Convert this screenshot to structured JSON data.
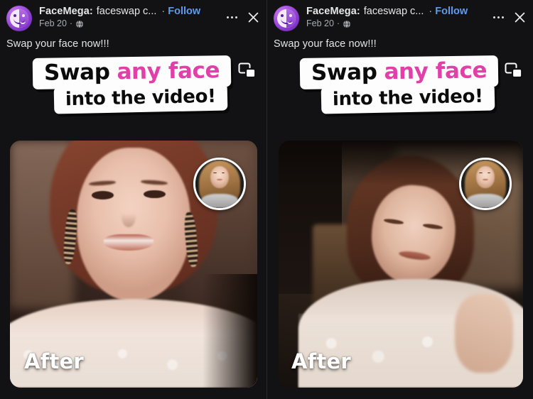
{
  "post": {
    "page_name": "FaceMega",
    "name_separator": ":",
    "page_subtitle": "faceswap c...",
    "follow_dot": "·",
    "follow_label": "Follow",
    "date": "Feb 20",
    "meta_dot": "·",
    "privacy_icon": "globe-icon",
    "caption": "Swap your face now!!!",
    "more_icon": "dots-icon",
    "close_icon": "close-icon",
    "pip_icon": "picture-in-picture-icon",
    "colors": {
      "background": "#121214",
      "text": "#e4e6ea",
      "muted_text": "#a9acb3",
      "link": "#5c9bf0",
      "promo_pink": "#e040a8",
      "promo_black": "#0b0b0b",
      "promo_card": "#fdfdfd",
      "logo_purple": "#a04fe0"
    }
  },
  "promo": {
    "line1_black": "Swap",
    "line1_pink": "any face",
    "line2": "into the video!"
  },
  "video": {
    "overlay_label": "After",
    "face_thumb_name": "source-face-thumbnail"
  },
  "panels": [
    {
      "id": "left",
      "label": "left-post-preview"
    },
    {
      "id": "right",
      "label": "right-post-preview"
    }
  ]
}
